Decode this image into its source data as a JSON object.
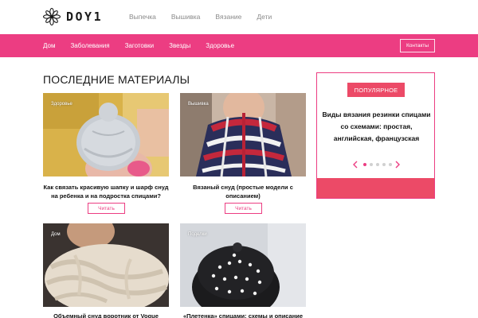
{
  "header": {
    "logo_text": "DOY1",
    "nav": [
      "Выпечка",
      "Вышивка",
      "Вязание",
      "Дети"
    ]
  },
  "menu": {
    "items": [
      "Дом",
      "Заболевания",
      "Заготовки",
      "Звезды",
      "Здоровье"
    ],
    "contacts": "Контакты"
  },
  "main": {
    "section_title": "ПОСЛЕДНИЕ МАТЕРИАЛЫ",
    "read_label": "Читать",
    "cards": [
      {
        "tag": "Здоровье",
        "title": "Как связать красивую шапку и шарф снуд на ребенка и на подростка спицами?"
      },
      {
        "tag": "Вышивка",
        "title": "Вязаный снуд (простые модели с описанием)"
      },
      {
        "tag": "Дом",
        "title": "Объемный снуд воротник от Vogue"
      },
      {
        "tag": "Поделки",
        "title": "«Плетенка» спицами: схемы и описание"
      }
    ]
  },
  "sidebar": {
    "badge": "ПОПУЛЯРНОЕ",
    "text": "Виды вязания резинки спицами со схемами: простая, английская, французская",
    "slides": 5,
    "active_slide": 1
  },
  "colors": {
    "accent": "#ec3d82",
    "badge": "#ec4a67"
  }
}
